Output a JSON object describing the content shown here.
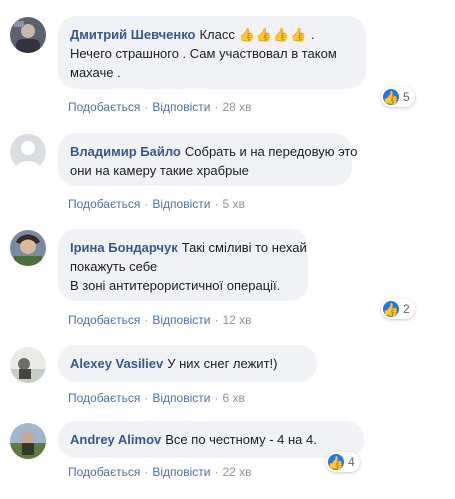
{
  "comments": [
    {
      "author": "Дмитрий Шевченко",
      "lines": [
        "Класс",
        "Нечего страшного . Сам участвовал в таком",
        "махаче ."
      ],
      "emoji": "👍👍👍👍",
      "after_emoji": " .",
      "like_label": "Подобається",
      "reply_label": "Відповісти",
      "time": "28 хв",
      "reaction_count": "5",
      "avatar_icon": "user-photo-avatar"
    },
    {
      "author": "Владимир Байло",
      "lines": [
        "Собрать и на передовую это",
        "они на камеру такие храбрые"
      ],
      "like_label": "Подобається",
      "reply_label": "Відповісти",
      "time": "5 хв",
      "avatar_icon": "default-silhouette-avatar"
    },
    {
      "author": "Ірина Бондарчук",
      "lines": [
        "Такі сміливі то нехай",
        "покажуть себе",
        "В зоні антитерористичної операції."
      ],
      "like_label": "Подобається",
      "reply_label": "Відповісти",
      "time": "12 хв",
      "reaction_count": "2",
      "avatar_icon": "user-photo-avatar"
    },
    {
      "author": "Alexey Vasiliev",
      "lines": [
        "У них снег лежит!)"
      ],
      "like_label": "Подобається",
      "reply_label": "Відповісти",
      "time": "6 хв",
      "avatar_icon": "user-photo-avatar"
    },
    {
      "author": "Andrey Alimov",
      "lines": [
        "Все по честному - 4 на 4."
      ],
      "like_label": "Подобається",
      "reply_label": "Відповісти",
      "time": "22 хв",
      "reaction_count": "4",
      "avatar_icon": "user-photo-avatar"
    }
  ],
  "colors": {
    "author": "#365899",
    "bubble": "#f0f2f5",
    "action": "#4b6fb3",
    "meta": "#8d949e",
    "like_blue": "#1877f2"
  }
}
